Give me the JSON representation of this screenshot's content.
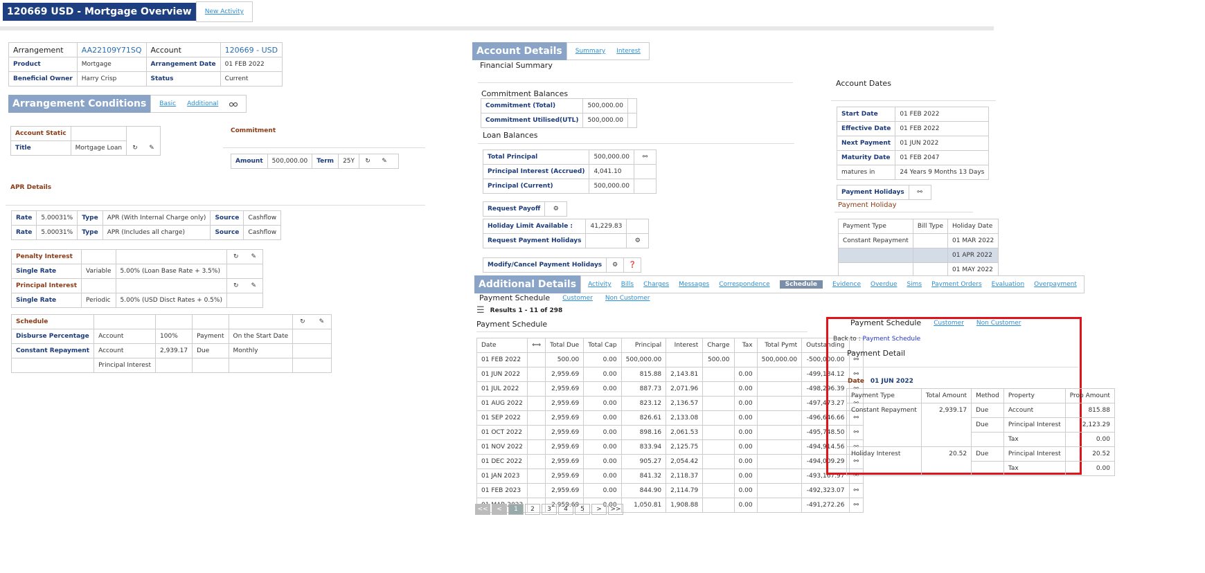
{
  "header": {
    "title": "120669 USD - Mortgage Overview",
    "new_activity": "New Activity"
  },
  "arrangement": {
    "arrangement_label": "Arrangement",
    "arrangement_value": "AA22109Y71SQ",
    "account_label": "Account",
    "account_value": "120669 - USD",
    "product_label": "Product",
    "product_value": "Mortgage",
    "arr_date_label": "Arrangement Date",
    "arr_date_value": "01 FEB 2022",
    "owner_label": "Beneficial Owner",
    "owner_value": "Harry Crisp",
    "status_label": "Status",
    "status_value": "Current"
  },
  "arr_conditions": {
    "title": "Arrangement Conditions",
    "tab_basic": "Basic",
    "tab_additional": "Additional"
  },
  "account_static": {
    "heading": "Account Static",
    "title_label": "Title",
    "title_value": "Mortgage Loan"
  },
  "commitment": {
    "heading": "Commitment",
    "amount_label": "Amount",
    "amount_value": "500,000.00",
    "term_label": "Term",
    "term_value": "25Y"
  },
  "apr": {
    "heading": "APR Details",
    "rows": [
      {
        "rate_label": "Rate",
        "rate": "5.00031%",
        "type_label": "Type",
        "type": "APR (With Internal Charge only)",
        "source_label": "Source",
        "source": "Cashflow"
      },
      {
        "rate_label": "Rate",
        "rate": "5.00031%",
        "type_label": "Type",
        "type": "APR (Includes all charge)",
        "source_label": "Source",
        "source": "Cashflow"
      }
    ]
  },
  "interest": {
    "penalty_heading": "Penalty Interest",
    "penalty_rate_label": "Single Rate",
    "penalty_kind": "Variable",
    "penalty_value": "5.00% (Loan Base Rate + 3.5%)",
    "principal_heading": "Principal Interest",
    "principal_rate_label": "Single Rate",
    "principal_kind": "Periodic",
    "principal_value": "5.00% (USD Disct Rates + 0.5%)"
  },
  "schedule": {
    "heading": "Schedule",
    "disburse_label": "Disburse Percentage",
    "disburse_prop": "Account",
    "disburse_value": "100%",
    "disburse_type": "Payment",
    "disburse_when": "On the Start Date",
    "constant_label": "Constant Repayment",
    "constant_prop": "Account",
    "constant_value": "2,939.17",
    "constant_type": "Due",
    "constant_freq": "Monthly",
    "constant_prop2": "Principal Interest"
  },
  "account_details": {
    "title": "Account Details",
    "tab_summary": "Summary",
    "tab_interest": "Interest",
    "financial_summary": "Financial Summary"
  },
  "commitment_balances": {
    "heading": "Commitment Balances",
    "total_label": "Commitment (Total)",
    "total_value": "500,000.00",
    "utilised_label": "Commitment Utilised(UTL)",
    "utilised_value": "500,000.00"
  },
  "loan_balances": {
    "heading": "Loan Balances",
    "total_label": "Total Principal",
    "total_value": "500,000.00",
    "accrued_label": "Principal Interest (Accrued)",
    "accrued_value": "4,041.10",
    "current_label": "Principal (Current)",
    "current_value": "500,000.00"
  },
  "actions": {
    "request_payoff": "Request Payoff",
    "holiday_limit_label": "Holiday Limit Available :",
    "holiday_limit_value": "41,229.83",
    "request_holidays": "Request Payment Holidays",
    "modify_holidays": "Modify/Cancel Payment Holidays"
  },
  "account_dates": {
    "heading": "Account Dates",
    "start_label": "Start Date",
    "start_value": "01 FEB 2022",
    "effective_label": "Effective Date",
    "effective_value": "01 FEB 2022",
    "next_label": "Next Payment",
    "next_value": "01 JUN 2022",
    "maturity_label": "Maturity Date",
    "maturity_value": "01 FEB 2047",
    "matures_label": "matures in",
    "matures_value": "24 Years 9 Months 13 Days"
  },
  "payment_holidays": {
    "button": "Payment Holidays",
    "heading": "Payment Holiday",
    "columns": [
      "Payment Type",
      "Bill Type",
      "Holiday Date"
    ],
    "rows": [
      [
        "Constant Repayment",
        "",
        "01 MAR 2022"
      ],
      [
        "",
        "",
        "01 APR 2022"
      ],
      [
        "",
        "",
        "01 MAY 2022"
      ]
    ]
  },
  "additional_details": {
    "title": "Additional Details",
    "tabs": [
      "Activity",
      "Bills",
      "Charges",
      "Messages",
      "Correspondence",
      "Schedule",
      "Evidence",
      "Overdue",
      "Sims",
      "Payment Orders",
      "Evaluation",
      "Overpayment"
    ],
    "active_tab": "Schedule"
  },
  "payment_schedule": {
    "heading": "Payment Schedule",
    "tab_customer": "Customer",
    "tab_non_customer": "Non Customer",
    "results": "Results 1 - 11 of 298",
    "subheading": "Payment Schedule",
    "columns": [
      "Date",
      "",
      "Total Due",
      "Total Cap",
      "Principal",
      "Interest",
      "Charge",
      "Tax",
      "Total Pymt",
      "Outstanding",
      ""
    ],
    "rows": [
      [
        "01 FEB 2022",
        "500.00",
        "0.00",
        "500,000.00",
        "",
        "500.00",
        "",
        "500,000.00",
        "-500,000.00"
      ],
      [
        "01 JUN 2022",
        "2,959.69",
        "0.00",
        "815.88",
        "2,143.81",
        "",
        "0.00",
        "",
        "-499,184.12"
      ],
      [
        "01 JUL 2022",
        "2,959.69",
        "0.00",
        "887.73",
        "2,071.96",
        "",
        "0.00",
        "",
        "-498,296.39"
      ],
      [
        "01 AUG 2022",
        "2,959.69",
        "0.00",
        "823.12",
        "2,136.57",
        "",
        "0.00",
        "",
        "-497,473.27"
      ],
      [
        "01 SEP 2022",
        "2,959.69",
        "0.00",
        "826.61",
        "2,133.08",
        "",
        "0.00",
        "",
        "-496,646.66"
      ],
      [
        "01 OCT 2022",
        "2,959.69",
        "0.00",
        "898.16",
        "2,061.53",
        "",
        "0.00",
        "",
        "-495,748.50"
      ],
      [
        "01 NOV 2022",
        "2,959.69",
        "0.00",
        "833.94",
        "2,125.75",
        "",
        "0.00",
        "",
        "-494,914.56"
      ],
      [
        "01 DEC 2022",
        "2,959.69",
        "0.00",
        "905.27",
        "2,054.42",
        "",
        "0.00",
        "",
        "-494,009.29"
      ],
      [
        "01 JAN 2023",
        "2,959.69",
        "0.00",
        "841.32",
        "2,118.37",
        "",
        "0.00",
        "",
        "-493,167.97"
      ],
      [
        "01 FEB 2023",
        "2,959.69",
        "0.00",
        "844.90",
        "2,114.79",
        "",
        "0.00",
        "",
        "-492,323.07"
      ],
      [
        "01 MAR 2023",
        "2,959.69",
        "0.00",
        "1,050.81",
        "1,908.88",
        "",
        "0.00",
        "",
        "-491,272.26"
      ]
    ],
    "pagination": [
      "<<",
      "<",
      "1",
      "2",
      "3",
      "4",
      "5",
      ">",
      ">>"
    ]
  },
  "payment_detail": {
    "heading": "Payment Schedule",
    "tab_customer": "Customer",
    "tab_non_customer": "Non Customer",
    "back_label": "Back to :",
    "back_link": "Payment Schedule",
    "title": "Payment Detail",
    "date_label": "Date",
    "date_value": "01 JUN 2022",
    "columns": [
      "Payment Type",
      "Total Amount",
      "Method",
      "Property",
      "Prop Amount"
    ],
    "rows": [
      [
        "Constant Repayment",
        "2,939.17",
        "Due",
        "Account",
        "815.88"
      ],
      [
        "",
        "",
        "Due",
        "Principal Interest",
        "2,123.29"
      ],
      [
        "",
        "",
        "",
        "Tax",
        "0.00"
      ],
      [
        "Holiday Interest",
        "20.52",
        "Due",
        "Principal Interest",
        "20.52"
      ],
      [
        "",
        "",
        "",
        "Tax",
        "0.00"
      ]
    ]
  },
  "colors": {
    "header_bg": "#1d3f82",
    "section_bar": "#8aa4c8",
    "highlight_border": "#e0131a",
    "active_tab": "#7a8ea8",
    "selected_row": "#d4dce8"
  }
}
